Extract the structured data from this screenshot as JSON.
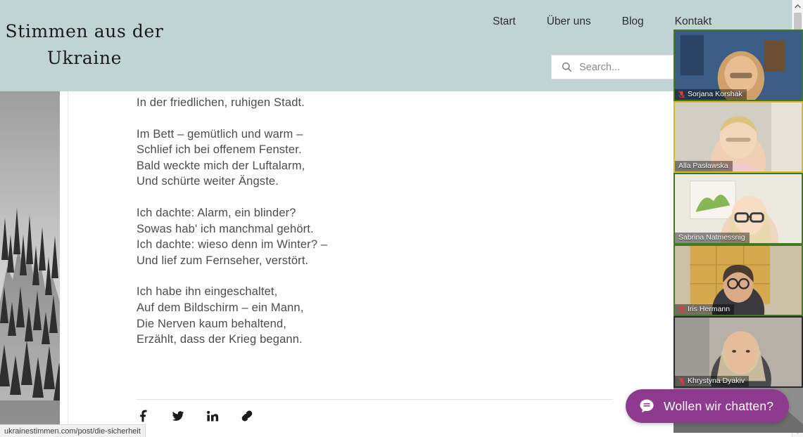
{
  "header": {
    "logo_line1": "Stimmen aus der",
    "logo_line2": "Ukraine",
    "background_color": "#bfd4d3",
    "nav": [
      {
        "label": "Start",
        "name": "nav-item-start"
      },
      {
        "label": "Über uns",
        "name": "nav-item-ueber-uns"
      },
      {
        "label": "Blog",
        "name": "nav-item-blog"
      },
      {
        "label": "Kontakt",
        "name": "nav-item-kontakt"
      }
    ],
    "search": {
      "placeholder": "Search...",
      "value": "",
      "icon": "search-icon"
    }
  },
  "article": {
    "poem": {
      "stanzas": [
        {
          "lines": [
            "In der friedlichen, ruhigen Stadt."
          ]
        },
        {
          "lines": [
            "Im Bett – gemütlich und warm –",
            "Schlief ich bei offenem Fenster.",
            "Bald weckte mich der Luftalarm,",
            "Und schürte weiter Ängste."
          ]
        },
        {
          "lines": [
            "Ich dachte: Alarm, ein blinder?",
            "Sowas hab' ich manchmal gehört.",
            "Ich dachte: wieso denn im Winter? –",
            "Und lief zum Fernseher, verstört."
          ]
        },
        {
          "lines": [
            "Ich habe ihn eingeschaltet,",
            "Auf dem Bildschirm – ein Mann,",
            "Die Nerven kaum behaltend,",
            "Erzählt, dass der Krieg begann."
          ]
        }
      ]
    },
    "share": [
      {
        "name": "facebook-share-icon",
        "label": "Facebook"
      },
      {
        "name": "twitter-share-icon",
        "label": "Twitter"
      },
      {
        "name": "linkedin-share-icon",
        "label": "LinkedIn"
      },
      {
        "name": "copy-link-icon",
        "label": "Link kopieren"
      }
    ],
    "side_photo_alt": "Schwarz-weiß Landschaftsfoto"
  },
  "browser": {
    "status_url": "ukrainestimmen.com/post/die-sicherheit",
    "scrollbar": {
      "up_arrow": "▲",
      "down_arrow": "▼"
    }
  },
  "video_call": {
    "participants": [
      {
        "name": "Sorjana Korshak",
        "border": "green",
        "muted": true,
        "skin": "#e6b893",
        "hair": "#c8a273",
        "bg": "#3c5e86"
      },
      {
        "name": "Alla Pasławska",
        "border": "yellow",
        "muted": false,
        "skin": "#eccba8",
        "hair": "#d7c07a",
        "bg": "#cfc9bd"
      },
      {
        "name": "Sabrina Natmessnig",
        "border": "green",
        "muted": false,
        "skin": "#f0d2b4",
        "hair": "#e1cf9e",
        "bg": "#ece8dd"
      },
      {
        "name": "Iris Hermann",
        "border": "green",
        "muted": true,
        "skin": "#d8ab85",
        "hair": "#4a3b31",
        "bg": "#c79a4e"
      },
      {
        "name": "Khrystyna Dyakiv",
        "border": "none",
        "muted": true,
        "skin": "#e3bb9b",
        "hair": "#d2c3a4",
        "bg": "#b9b3ab"
      }
    ]
  },
  "chat_widget": {
    "label": "Wollen wir chatten?",
    "icon": "chat-bubble-icon",
    "color": "#8e3a8e"
  }
}
